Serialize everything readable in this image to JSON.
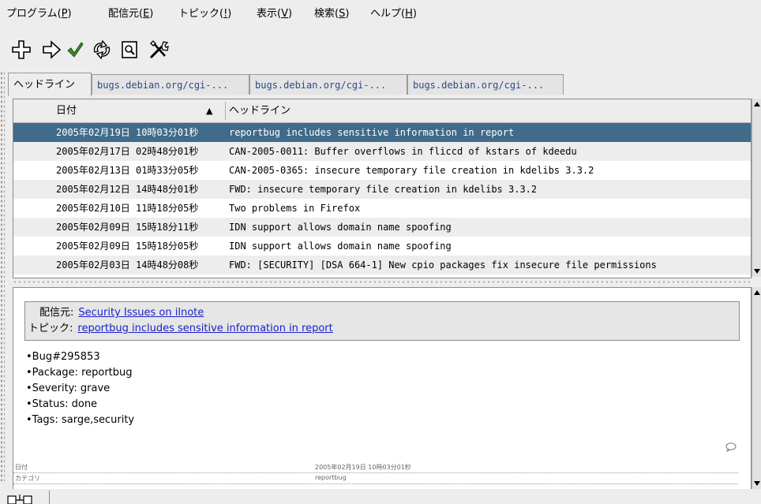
{
  "menubar": {
    "items": [
      {
        "label": "プログラム(",
        "key": "P",
        "end": ")"
      },
      {
        "label": "配信元(",
        "key": "E",
        "end": ")"
      },
      {
        "label": "トピック(",
        "key": "!",
        "end": ")"
      },
      {
        "label": "表示(",
        "key": "V",
        "end": ")"
      },
      {
        "label": "検索(",
        "key": "S",
        "end": ")"
      },
      {
        "label": "ヘルプ(",
        "key": "H",
        "end": ")"
      }
    ]
  },
  "toolbar": {
    "buttons": [
      {
        "icon": "add-feed-icon"
      },
      {
        "icon": "next-unread-icon"
      },
      {
        "icon": "mark-read-icon"
      },
      {
        "icon": "refresh-icon"
      },
      {
        "icon": "search-icon"
      },
      {
        "icon": "preferences-icon"
      }
    ]
  },
  "tabs": [
    "ヘッドライン",
    "bugs.debian.org/cgi-...",
    "bugs.debian.org/cgi-...",
    "bugs.debian.org/cgi-..."
  ],
  "headlines": {
    "columns": {
      "date": "日付",
      "title": "ヘッドライン"
    },
    "sort_indicator": "▲",
    "rows": [
      {
        "date": "2005年02月19日 10時03分01秒",
        "title": "reportbug includes sensitive information in report"
      },
      {
        "date": "2005年02月17日 02時48分01秒",
        "title": "CAN-2005-0011: Buffer overflows in fliccd of kstars of kdeedu"
      },
      {
        "date": "2005年02月13日 01時33分05秒",
        "title": "CAN-2005-0365: insecure temporary file creation in kdelibs 3.3.2"
      },
      {
        "date": "2005年02月12日 14時48分01秒",
        "title": "FWD: insecure temporary file creation in kdelibs 3.3.2"
      },
      {
        "date": "2005年02月10日 11時18分05秒",
        "title": "Two problems in Firefox"
      },
      {
        "date": "2005年02月09日 15時18分11秒",
        "title": "IDN support allows domain name spoofing"
      },
      {
        "date": "2005年02月09日 15時18分05秒",
        "title": "IDN support allows domain name spoofing"
      },
      {
        "date": "2005年02月03日 14時48分08秒",
        "title": "FWD: [SECURITY] [DSA 664-1] New cpio packages fix insecure file permissions"
      }
    ]
  },
  "preview": {
    "source_label": "配信元:",
    "source_value": "Security Issues on ilnote",
    "topic_label": "トピック:",
    "topic_value": "reportbug includes sensitive information in report",
    "bullets": [
      "Bug#295853",
      "Package: reportbug",
      "Severity: grave",
      "Status: done",
      "Tags: sarge,security"
    ],
    "footer": [
      {
        "key": "日付",
        "value": "2005年02月19日 10時03分01秒"
      },
      {
        "key": "カテゴリ",
        "value": "reportbug"
      }
    ]
  },
  "colors": {
    "selection": "#406b8a",
    "link": "#1a21c9",
    "tab_link": "#2b4a87"
  }
}
